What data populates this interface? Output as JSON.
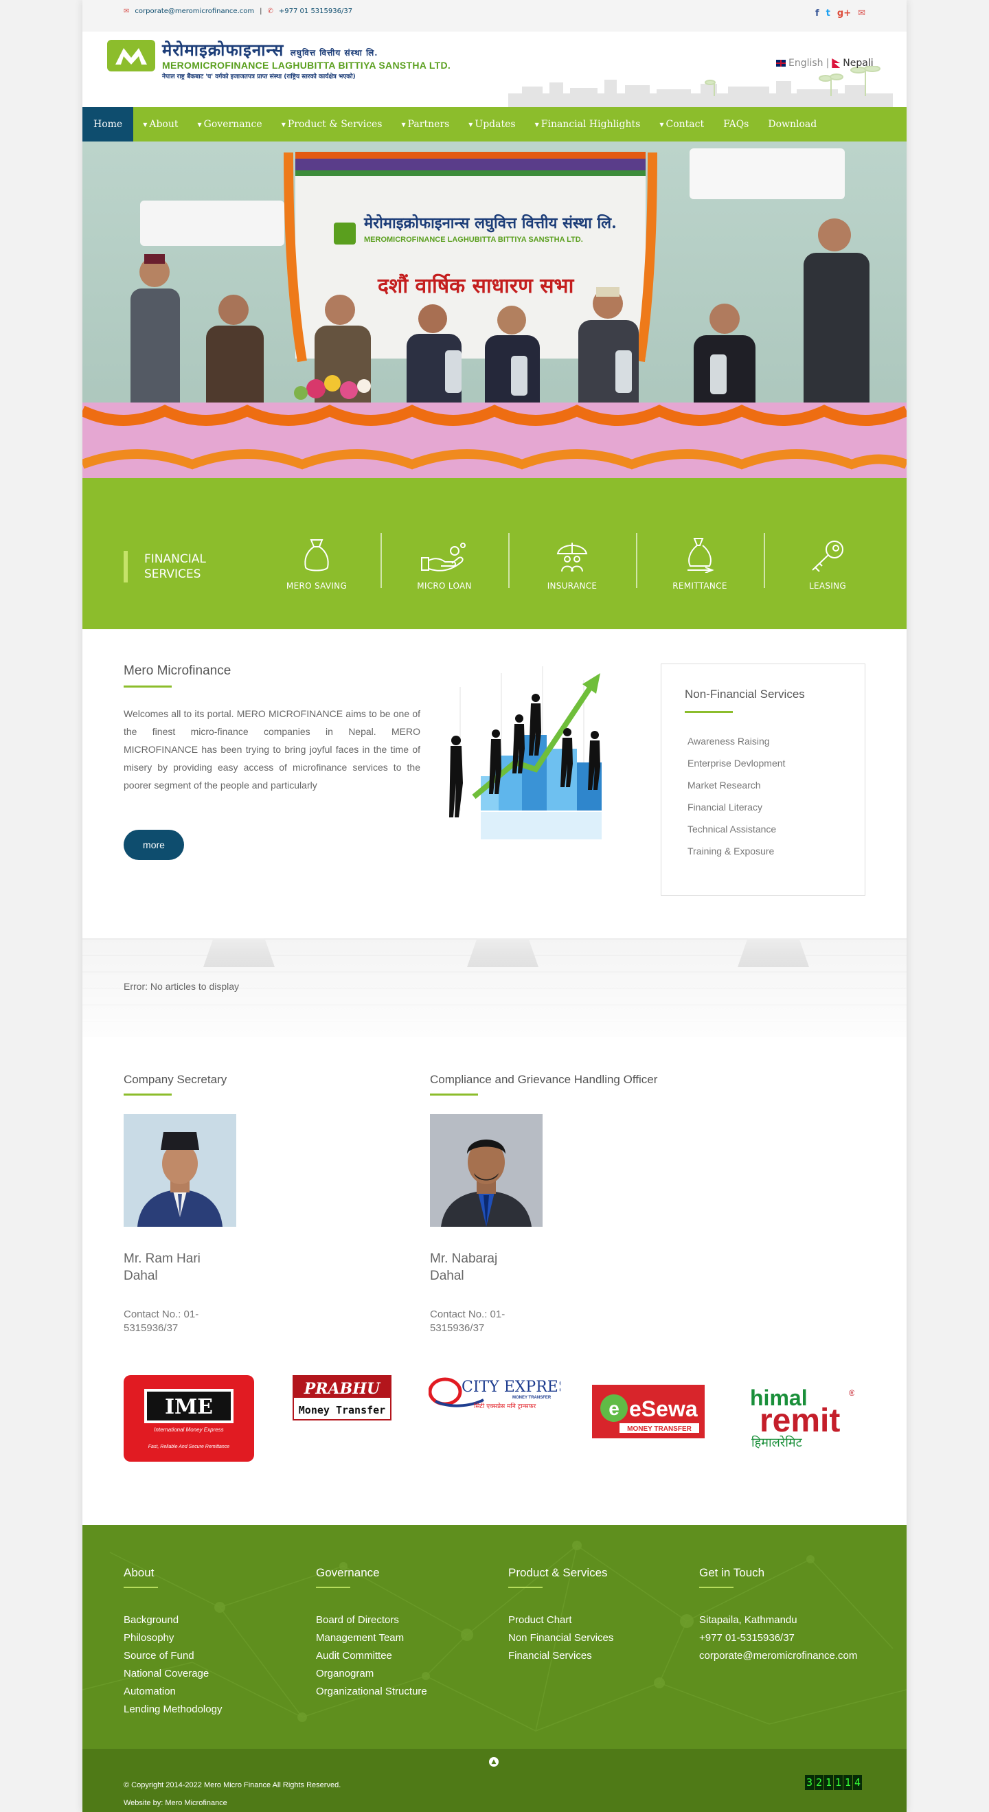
{
  "topbar": {
    "email": "corporate@meromicrofinance.com",
    "phone": "+977 01 5315936/37",
    "social": [
      "facebook-icon",
      "twitter-icon",
      "google-plus-icon",
      "envelope-icon"
    ]
  },
  "header": {
    "logo_nepali": "मेरोमाइक्रोफाइनान्स",
    "logo_nepali_suffix": "लघुवित्त वित्तीय संस्था लि.",
    "logo_english": "MEROMICROFINANCE LAGHUBITTA BITTIYA SANSTHA LTD.",
    "logo_tagline": "नेपाल राष्ट्र बैंकबाट 'घ' वर्गको इजाजतपत्र प्राप्त संस्था (राष्ट्रिय स्तरको कार्यक्षेत्र भएको)",
    "lang_english": "English",
    "lang_separator": "|",
    "lang_nepali": "Nepali"
  },
  "nav": {
    "items": [
      {
        "label": "Home",
        "active": true,
        "dropdown": false
      },
      {
        "label": "About",
        "dropdown": true
      },
      {
        "label": "Governance",
        "dropdown": true
      },
      {
        "label": "Product & Services",
        "dropdown": true
      },
      {
        "label": "Partners",
        "dropdown": true
      },
      {
        "label": "Updates",
        "dropdown": true
      },
      {
        "label": "Financial Highlights",
        "dropdown": true
      },
      {
        "label": "Contact",
        "dropdown": true
      },
      {
        "label": "FAQs",
        "dropdown": false
      },
      {
        "label": "Download",
        "dropdown": false
      }
    ]
  },
  "hero": {
    "banner_nepali": "दशौं वार्षिक साधारण सभा",
    "banner_org_nepali": "मेरोमाइक्रोफाइनान्स लघुवित्त वित्तीय संस्था लि.",
    "banner_org_english": "MEROMICROFINANCE LAGHUBITTA BITTIYA SANSTHA LTD."
  },
  "financial_services": {
    "label_line1": "FINANCIAL",
    "label_line2": "SERVICES",
    "items": [
      {
        "label": "MERO SAVING",
        "icon": "money-bag-icon"
      },
      {
        "label": "MICRO LOAN",
        "icon": "hand-coins-icon"
      },
      {
        "label": "INSURANCE",
        "icon": "umbrella-people-icon"
      },
      {
        "label": "REMITTANCE",
        "icon": "money-transfer-icon"
      },
      {
        "label": "LEASING",
        "icon": "key-icon"
      }
    ]
  },
  "about": {
    "title": "Mero Microfinance",
    "text": "Welcomes all to its portal. MERO MICROFINANCE aims to be one of the finest micro-finance companies in Nepal. MERO MICROFINANCE has been trying to bring joyful faces in the time of misery by providing easy access of microfinance services to the poorer segment of the people and particularly",
    "more_label": "more"
  },
  "non_financial": {
    "title": "Non-Financial Services",
    "items": [
      "Awareness Raising",
      "Enterprise Devlopment",
      "Market Research",
      "Financial Literacy",
      "Technical Assistance",
      "Training & Exposure"
    ]
  },
  "articles": {
    "error": "Error: No articles to display"
  },
  "people": [
    {
      "role": "Company Secretary",
      "name_line1": "Mr. Ram Hari",
      "name_line2": "Dahal",
      "contact_line1": "Contact No.: 01-",
      "contact_line2": "5315936/37"
    },
    {
      "role": "Compliance and Grievance Handling Officer",
      "name_line1": "Mr. Nabaraj",
      "name_line2": "Dahal",
      "contact_line1": "Contact No.: 01-",
      "contact_line2": "5315936/37"
    }
  ],
  "partners": {
    "ime": {
      "name": "IME",
      "sub": "International Money Express",
      "tag": "Fast, Reliable And Secure Remittance"
    },
    "prabhu": {
      "name": "PRABHU",
      "sub": "Money Transfer"
    },
    "cityexpress": {
      "name": "CITY EXPRESS",
      "sub": "MONEY TRANSFER",
      "tag": "सिटी एक्सप्रेस मनि ट्रान्सफर"
    },
    "esewa": {
      "name": "eSewa",
      "sub": "MONEY TRANSFER"
    },
    "himal": {
      "line1": "himal",
      "line2": "remit",
      "nepali": "हिमालरेमिट",
      "reg": "®"
    }
  },
  "footer": {
    "columns": [
      {
        "title": "About",
        "links": [
          "Background",
          "Philosophy",
          "Source of Fund",
          "National Coverage",
          "Automation",
          "Lending Methodology"
        ]
      },
      {
        "title": "Governance",
        "links": [
          "Board of Directors",
          "Management Team",
          "Audit Committee",
          "Organogram",
          "Organizational Structure"
        ]
      },
      {
        "title": "Product & Services",
        "links": [
          "Product Chart",
          "Non Financial Services",
          "Financial Services"
        ]
      },
      {
        "title": "Get in Touch",
        "links": [
          "Sitapaila, Kathmandu",
          "+977 01-5315936/37",
          "corporate@meromicrofinance.com"
        ]
      }
    ],
    "copyright": "© Copyright 2014-2022 Mero Micro Finance All Rights Reserved.",
    "website_by": "Website by: Mero Microfinance",
    "counter_digits": [
      "3",
      "2",
      "1",
      "1",
      "1",
      "4"
    ]
  },
  "colors": {
    "brand_green": "#8cbd2c",
    "brand_blue": "#0e4d6e",
    "footer_green": "#5f8f1e"
  }
}
